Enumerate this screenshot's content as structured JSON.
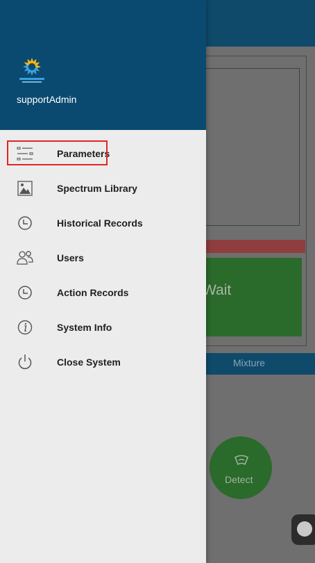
{
  "background": {
    "wait_text": "Wait",
    "mixture_label": "Mixture",
    "detect_label": "Detect"
  },
  "drawer": {
    "logo": "optosky-logo",
    "user_name": "supportAdmin",
    "items": [
      {
        "label": "Parameters",
        "icon": "parameters-icon",
        "highlighted": true
      },
      {
        "label": "Spectrum Library",
        "icon": "image-icon"
      },
      {
        "label": "Historical Records",
        "icon": "clock-icon"
      },
      {
        "label": "Users",
        "icon": "users-icon"
      },
      {
        "label": "Action Records",
        "icon": "clock-icon"
      },
      {
        "label": "System Info",
        "icon": "info-icon"
      },
      {
        "label": "Close System",
        "icon": "power-icon"
      }
    ]
  },
  "colors": {
    "header": "#0a4a70",
    "drawer_bg": "#ececec",
    "highlight": "#e32424",
    "wait_green": "#2a6a2a",
    "progress_red": "#8f3d3d"
  }
}
